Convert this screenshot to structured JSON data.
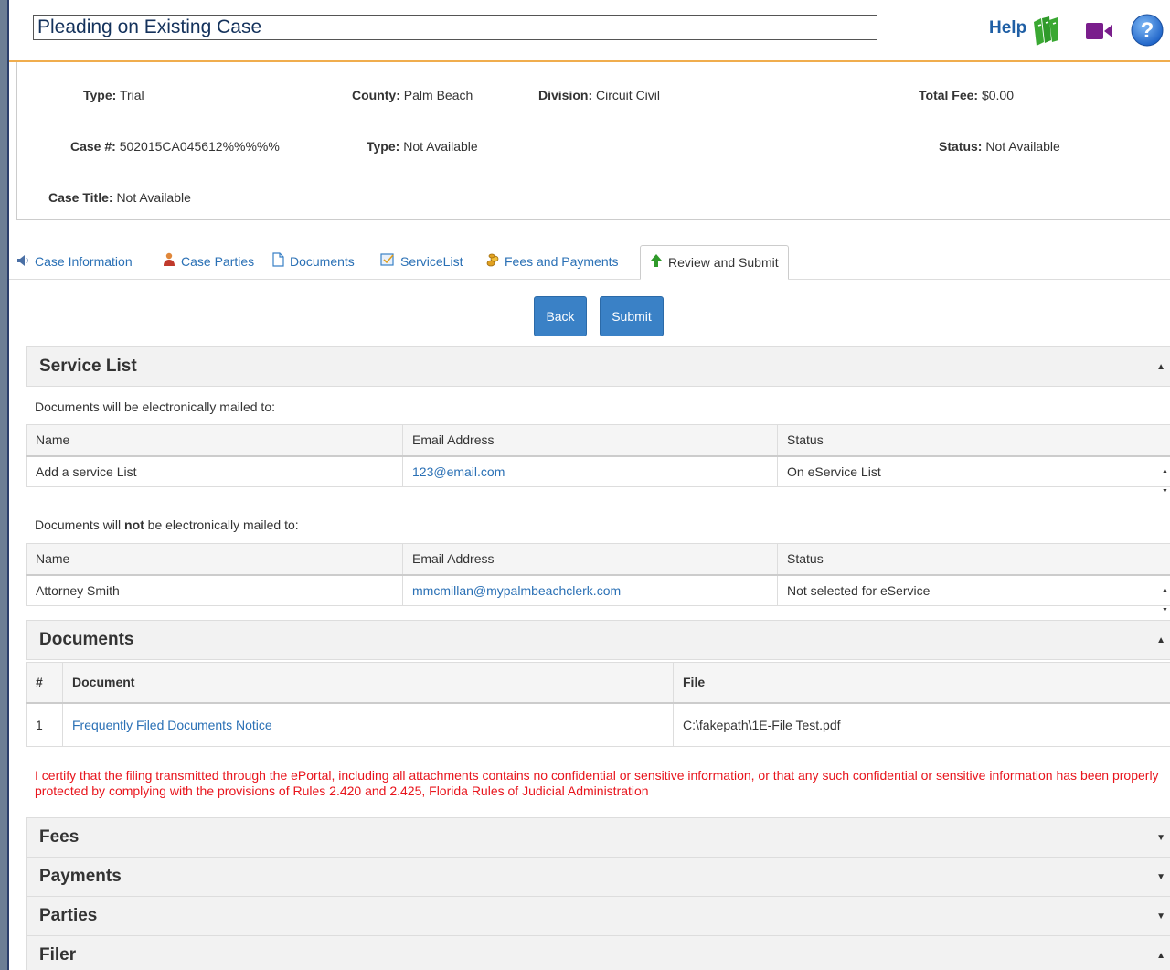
{
  "header": {
    "title": "Pleading on Existing Case",
    "help_label": "Help"
  },
  "case_info": {
    "type_label": "Type:",
    "type_value": "Trial",
    "county_label": "County:",
    "county_value": "Palm Beach",
    "division_label": "Division:",
    "division_value": "Circuit Civil",
    "total_fee_label": "Total Fee:",
    "total_fee_value": "$0.00",
    "case_no_label": "Case #:",
    "case_no_value": "502015CA045612%%%%%",
    "type2_label": "Type:",
    "type2_value": "Not Available",
    "status_label": "Status:",
    "status_value": "Not Available",
    "case_title_label": "Case Title:",
    "case_title_value": "Not Available"
  },
  "tabs": [
    {
      "label": "Case Information"
    },
    {
      "label": "Case Parties"
    },
    {
      "label": "Documents"
    },
    {
      "label": "ServiceList"
    },
    {
      "label": "Fees and Payments"
    },
    {
      "label": "Review and Submit"
    }
  ],
  "buttons": {
    "back": "Back",
    "submit": "Submit"
  },
  "service_list": {
    "title": "Service List",
    "mailed_intro": "Documents will be electronically mailed to:",
    "not_intro_prefix": "Documents will ",
    "not_intro_bold": "not",
    "not_intro_suffix": " be electronically mailed to:",
    "columns": [
      "Name",
      "Email Address",
      "Status"
    ],
    "mailed_rows": [
      {
        "name": "Add a service List",
        "email": "123@email.com",
        "status": "On eService List"
      }
    ],
    "not_rows": [
      {
        "name": "Attorney Smith",
        "email": "mmcmillan@mypalmbeachclerk.com",
        "status": "Not selected for eService"
      }
    ]
  },
  "documents": {
    "title": "Documents",
    "columns": [
      "#",
      "Document",
      "File"
    ],
    "rows": [
      {
        "num": "1",
        "document": "Frequently Filed Documents Notice",
        "file": "C:\\fakepath\\1E-File Test.pdf"
      }
    ],
    "certification": "I certify that the filing transmitted through the ePortal, including all attachments contains no confidential or sensitive information, or that any such confidential or sensitive information has been properly protected by complying with the provisions of Rules 2.420 and 2.425, Florida Rules of Judicial Administration"
  },
  "sections": {
    "fees": "Fees",
    "payments": "Payments",
    "parties": "Parties",
    "filer": "Filer"
  },
  "colors": {
    "link": "#2a70b5",
    "button": "#3a81c6",
    "accent": "#f0ad4e",
    "warning_text": "#e8141c",
    "help_blue": "#1f5fa5",
    "icon_green": "#3aa832",
    "icon_purple": "#7a1e8c"
  },
  "icons": [
    "books-icon",
    "video-camera-icon",
    "question-circle-icon",
    "speaker-icon",
    "person-icon",
    "document-icon",
    "checklist-icon",
    "coins-icon",
    "up-arrow-icon"
  ]
}
